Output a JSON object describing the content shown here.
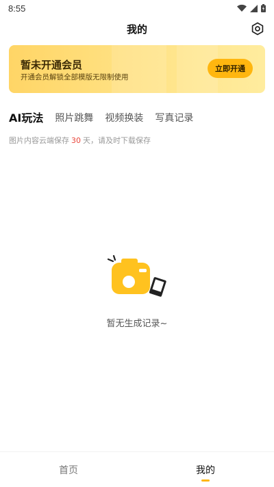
{
  "status_bar": {
    "time": "8:55",
    "icons": [
      "wifi-icon",
      "signal-icon",
      "battery-icon"
    ]
  },
  "header": {
    "title": "我的",
    "settings_icon": "gear-icon"
  },
  "vip_banner": {
    "title": "暂未开通会员",
    "description": "开通会员解锁全部模版无限制使用",
    "button_label": "立即开通"
  },
  "tabs": [
    {
      "label": "AI玩法",
      "active": true
    },
    {
      "label": "照片跳舞",
      "active": false
    },
    {
      "label": "视频换装",
      "active": false
    },
    {
      "label": "写真记录",
      "active": false
    }
  ],
  "notice": {
    "prefix": "图片内容云端保存",
    "days": "30",
    "suffix": "天，请及时下载保存"
  },
  "empty_state": {
    "text": "暂无生成记录~",
    "icon": "camera-icon"
  },
  "bottom_nav": [
    {
      "label": "首页",
      "active": false
    },
    {
      "label": "我的",
      "active": true
    }
  ],
  "colors": {
    "accent": "#ffb60f",
    "highlight_red": "#e9453a"
  }
}
